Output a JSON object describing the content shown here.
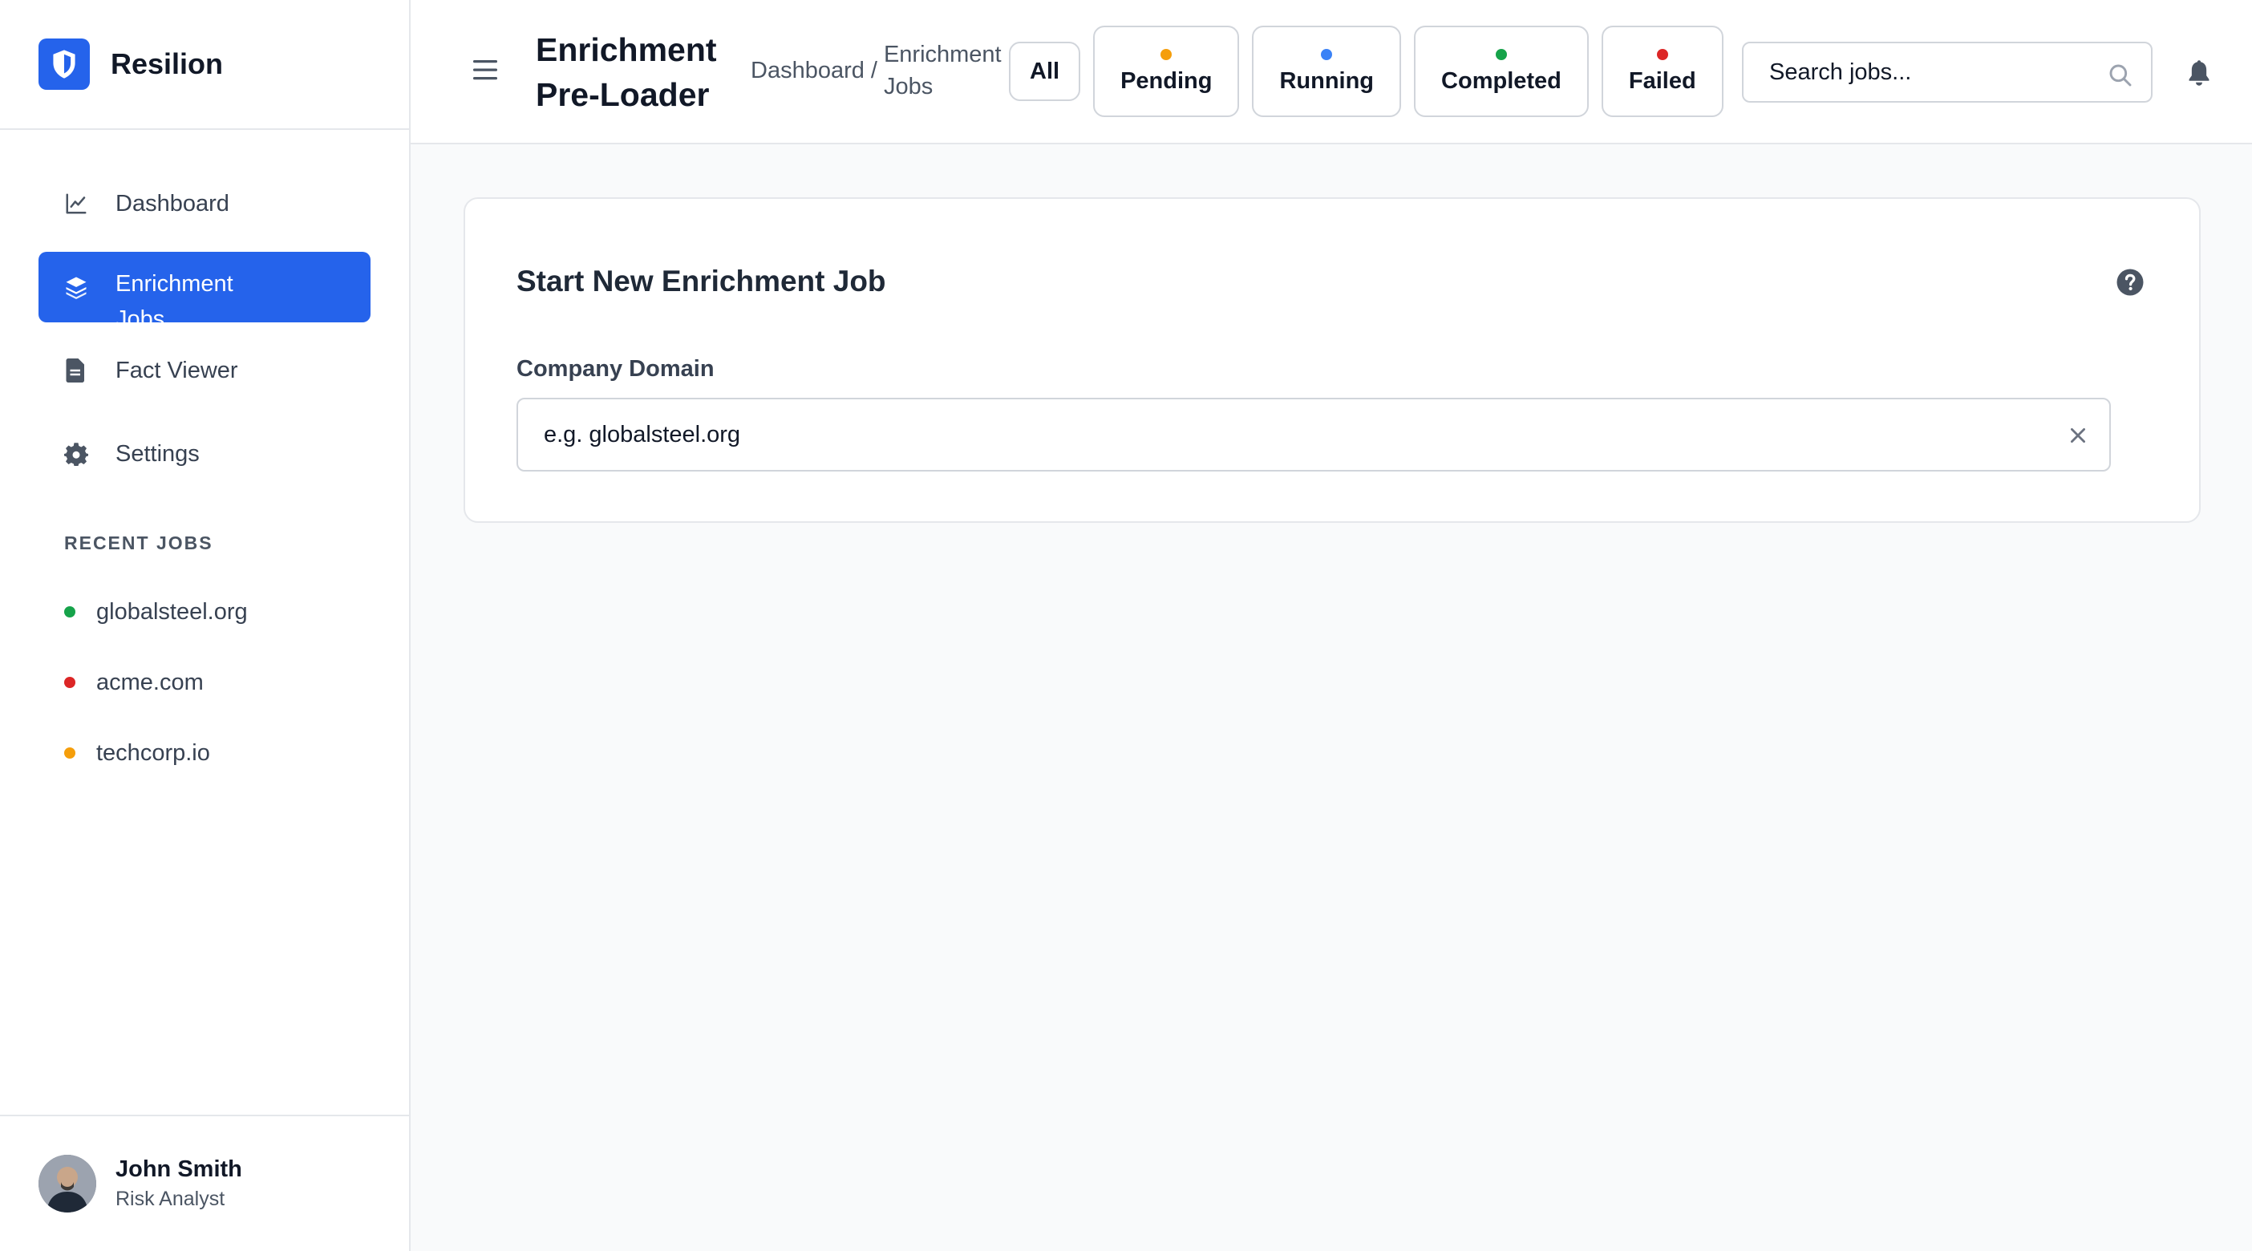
{
  "brand": {
    "name": "Resilion",
    "logo_icon": "shield-icon",
    "color": "#2563eb"
  },
  "sidebar": {
    "items": [
      {
        "label": "Dashboard",
        "icon": "chart-line-icon",
        "active": false
      },
      {
        "label": "Enrichment Jobs",
        "icon": "layers-icon",
        "active": true
      },
      {
        "label": "Fact Viewer",
        "icon": "document-icon",
        "active": false
      },
      {
        "label": "Settings",
        "icon": "gear-icon",
        "active": false
      }
    ],
    "recent_title": "RECENT JOBS",
    "recent_jobs": [
      {
        "label": "globalsteel.org",
        "status_color": "#16a34a"
      },
      {
        "label": "acme.com",
        "status_color": "#dc2626"
      },
      {
        "label": "techcorp.io",
        "status_color": "#f59e0b"
      }
    ]
  },
  "user": {
    "name": "John Smith",
    "role": "Risk Analyst"
  },
  "header": {
    "title": "Enrichment Pre-Loader",
    "breadcrumb": {
      "home": "Dashboard",
      "separator": "/",
      "current": "Enrichment Jobs"
    },
    "filters": [
      {
        "label": "All",
        "color": null
      },
      {
        "label": "Pending",
        "color": "#f59e0b"
      },
      {
        "label": "Running",
        "color": "#3b82f6"
      },
      {
        "label": "Completed",
        "color": "#16a34a"
      },
      {
        "label": "Failed",
        "color": "#dc2626"
      }
    ],
    "search": {
      "placeholder": "Search jobs...",
      "value": ""
    }
  },
  "card": {
    "title": "Start New Enrichment Job",
    "field_label": "Company Domain",
    "field_placeholder": "e.g. globalsteel.org",
    "field_value": ""
  }
}
